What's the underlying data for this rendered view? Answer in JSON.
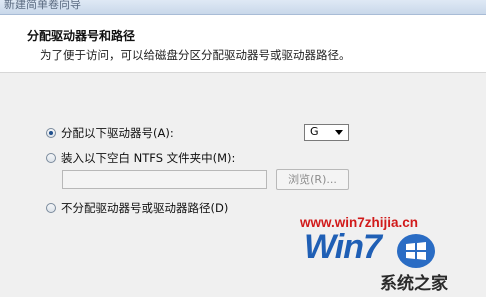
{
  "window": {
    "title": "新建简单卷向导"
  },
  "header": {
    "title": "分配驱动器号和路径",
    "subtitle": "为了便于访问，可以给磁盘分区分配驱动器号或驱动器路径。"
  },
  "options": {
    "assign_letter": {
      "label": "分配以下驱动器号(A):",
      "checked": true
    },
    "mount_folder": {
      "label": "装入以下空白 NTFS 文件夹中(M):",
      "checked": false
    },
    "no_assign": {
      "label": "不分配驱动器号或驱动器路径(D)",
      "checked": false
    }
  },
  "drive_select": {
    "value": "G"
  },
  "path_field": {
    "value": ""
  },
  "browse_button": {
    "label": "浏览(R)..."
  },
  "watermark": {
    "url": "www.win7zhijia.cn",
    "logo_text": "Win7",
    "site_name": "系统之家"
  },
  "colors": {
    "panel_background": "#f0f0f0",
    "watermark_url": "#d11a1a",
    "watermark_logo": "#1f5fb5"
  }
}
